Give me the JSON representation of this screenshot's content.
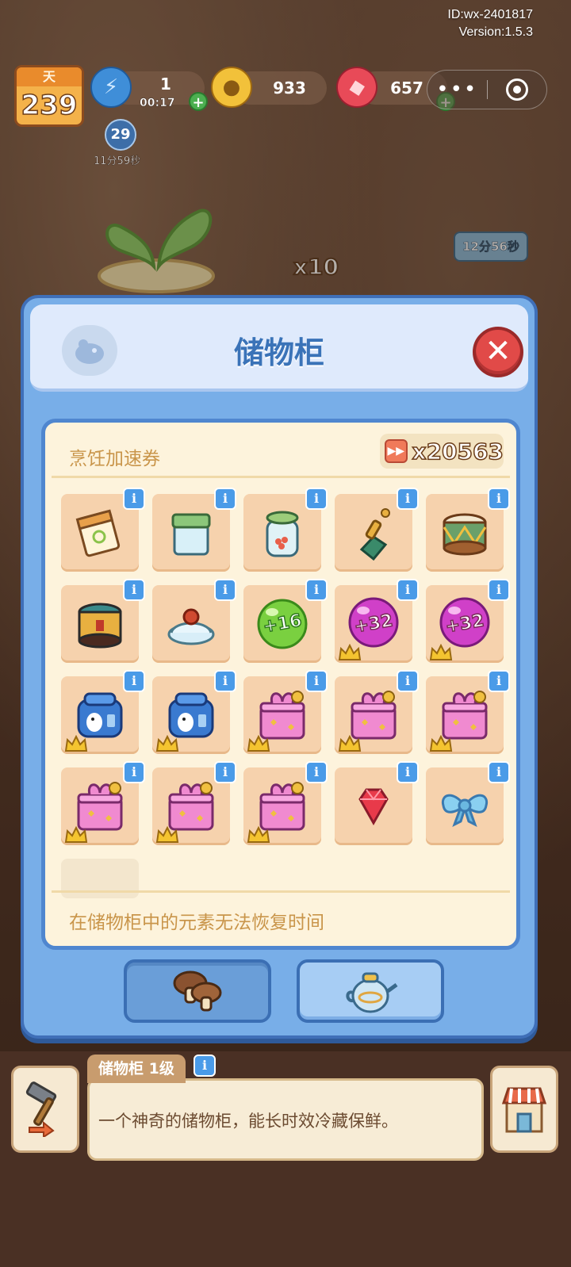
{
  "watermark": {
    "id": "ID:wx-2401817",
    "version": "Version:1.5.3"
  },
  "hud": {
    "day_label": "天",
    "day_value": "239",
    "energy_value": "1",
    "energy_timer": "00:17",
    "coins": "933",
    "gems": "657",
    "badge_value": "29",
    "badge_timer": "11分59秒"
  },
  "background": {
    "pot_multiplier": "x10",
    "timer_tag": "12分56秒"
  },
  "modal": {
    "title": "储物柜",
    "close_label": "✕",
    "speed_ticket_label": "烹饪加速券",
    "speed_ticket_count": "x20563",
    "footer_note": "在储物柜中的元素无法恢复时间",
    "items": [
      {
        "icon": "calendar-icon",
        "label": "",
        "crown": false
      },
      {
        "icon": "glass-container-icon",
        "label": "",
        "crown": false
      },
      {
        "icon": "seed-jar-icon",
        "label": "",
        "crown": false
      },
      {
        "icon": "green-gem-pendant-icon",
        "label": "",
        "crown": false
      },
      {
        "icon": "drum-icon",
        "label": "",
        "crown": false
      },
      {
        "icon": "hat-box-icon",
        "label": "",
        "crown": false
      },
      {
        "icon": "glass-lid-icon",
        "label": "",
        "crown": false
      },
      {
        "icon": "green-bubble-icon",
        "label": "+16",
        "crown": false
      },
      {
        "icon": "purple-bubble-icon",
        "label": "+32",
        "crown": true
      },
      {
        "icon": "purple-bubble-icon",
        "label": "+32",
        "crown": true
      },
      {
        "icon": "blue-backpack-icon",
        "label": "",
        "crown": true
      },
      {
        "icon": "blue-backpack-icon",
        "label": "",
        "crown": true
      },
      {
        "icon": "pink-gift-box-icon",
        "label": "",
        "crown": true
      },
      {
        "icon": "pink-gift-box-icon",
        "label": "",
        "crown": true
      },
      {
        "icon": "pink-gift-box-icon",
        "label": "",
        "crown": true
      },
      {
        "icon": "pink-gift-box-icon",
        "label": "",
        "crown": true
      },
      {
        "icon": "pink-gift-box-icon",
        "label": "",
        "crown": true
      },
      {
        "icon": "pink-gift-box-icon",
        "label": "",
        "crown": true
      },
      {
        "icon": "red-gem-icon",
        "label": "",
        "crown": false
      },
      {
        "icon": "blue-bow-icon",
        "label": "",
        "crown": false
      }
    ],
    "info_badge": "i"
  },
  "bottom": {
    "building_name": "储物柜 1级",
    "building_desc": "一个神奇的储物柜，能长时效冷藏保鲜。"
  }
}
